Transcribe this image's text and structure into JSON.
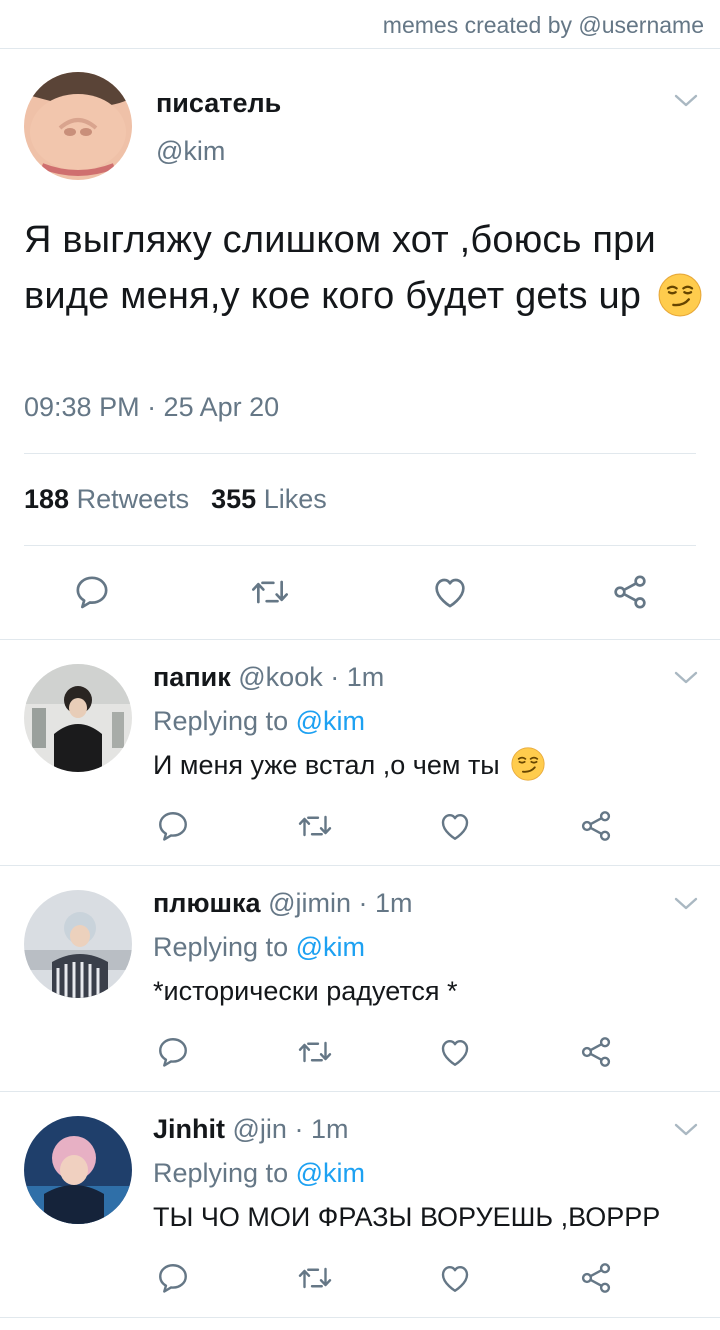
{
  "credit": "memes created by @username",
  "tweet": {
    "name": "писатель",
    "handle": "@kim",
    "text": "Я выгляжу слишком хот ,боюсь при виде меня,у кое кого будет gets up",
    "text_emoji": "smirking-face-emoji",
    "time": "09:38 PM · 25 Apr 20",
    "retweets_count": "188",
    "retweets_label": "Retweets",
    "likes_count": "355",
    "likes_label": "Likes"
  },
  "replies": [
    {
      "name": "папик",
      "handle": "@kook",
      "sep": "·",
      "time": "1m",
      "replying_label": "Replying to",
      "mention": "@kim",
      "text": "И меня уже встал ,о чем ты",
      "emoji": "smirking-face-emoji"
    },
    {
      "name": "плюшка",
      "handle": "@jimin",
      "sep": "·",
      "time": "1m",
      "replying_label": "Replying to",
      "mention": "@kim",
      "text": "*исторически радуется *"
    },
    {
      "name": "Jinhit",
      "handle": "@jin",
      "sep": "·",
      "time": "1m",
      "replying_label": "Replying to",
      "mention": "@kim",
      "text": "ТЫ ЧО МОИ ФРАЗЫ ВОРУЕШЬ ,ВОРРР"
    }
  ],
  "colors": {
    "text": "#14171a",
    "secondary": "#657786",
    "link": "#1da1f2",
    "divider": "#e1e8ed",
    "icon": "#657786"
  },
  "icons": [
    "chevron-down-icon",
    "reply-icon",
    "retweet-icon",
    "like-icon",
    "share-icon"
  ]
}
